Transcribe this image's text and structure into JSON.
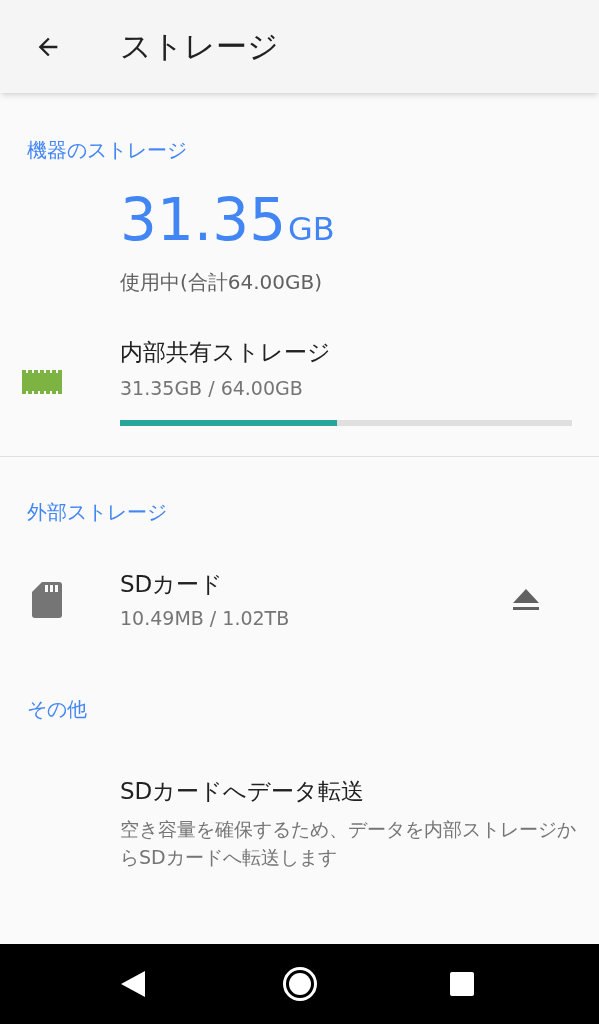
{
  "app_bar": {
    "title": "ストレージ"
  },
  "device_section": {
    "header": "機器のストレージ",
    "used_amount": "31.35",
    "used_unit": "GB",
    "used_caption": "使用中(合計64.00GB)",
    "items": [
      {
        "kind": "internal",
        "title": "内部共有ストレージ",
        "subtitle": "31.35GB / 64.00GB",
        "level": 0.48
      }
    ]
  },
  "external_section": {
    "header": "外部ストレージ",
    "items": [
      {
        "kind": "sdcard",
        "title": "SDカード",
        "subtitle": "10.49MB / 1.02TB",
        "ejectable": true
      }
    ]
  },
  "other_section": {
    "header": "その他",
    "items": [
      {
        "title": "SDカードへデータ転送",
        "description": "空き容量を確保するため、データを内部ストレージからSDカードへ転送します"
      }
    ]
  }
}
